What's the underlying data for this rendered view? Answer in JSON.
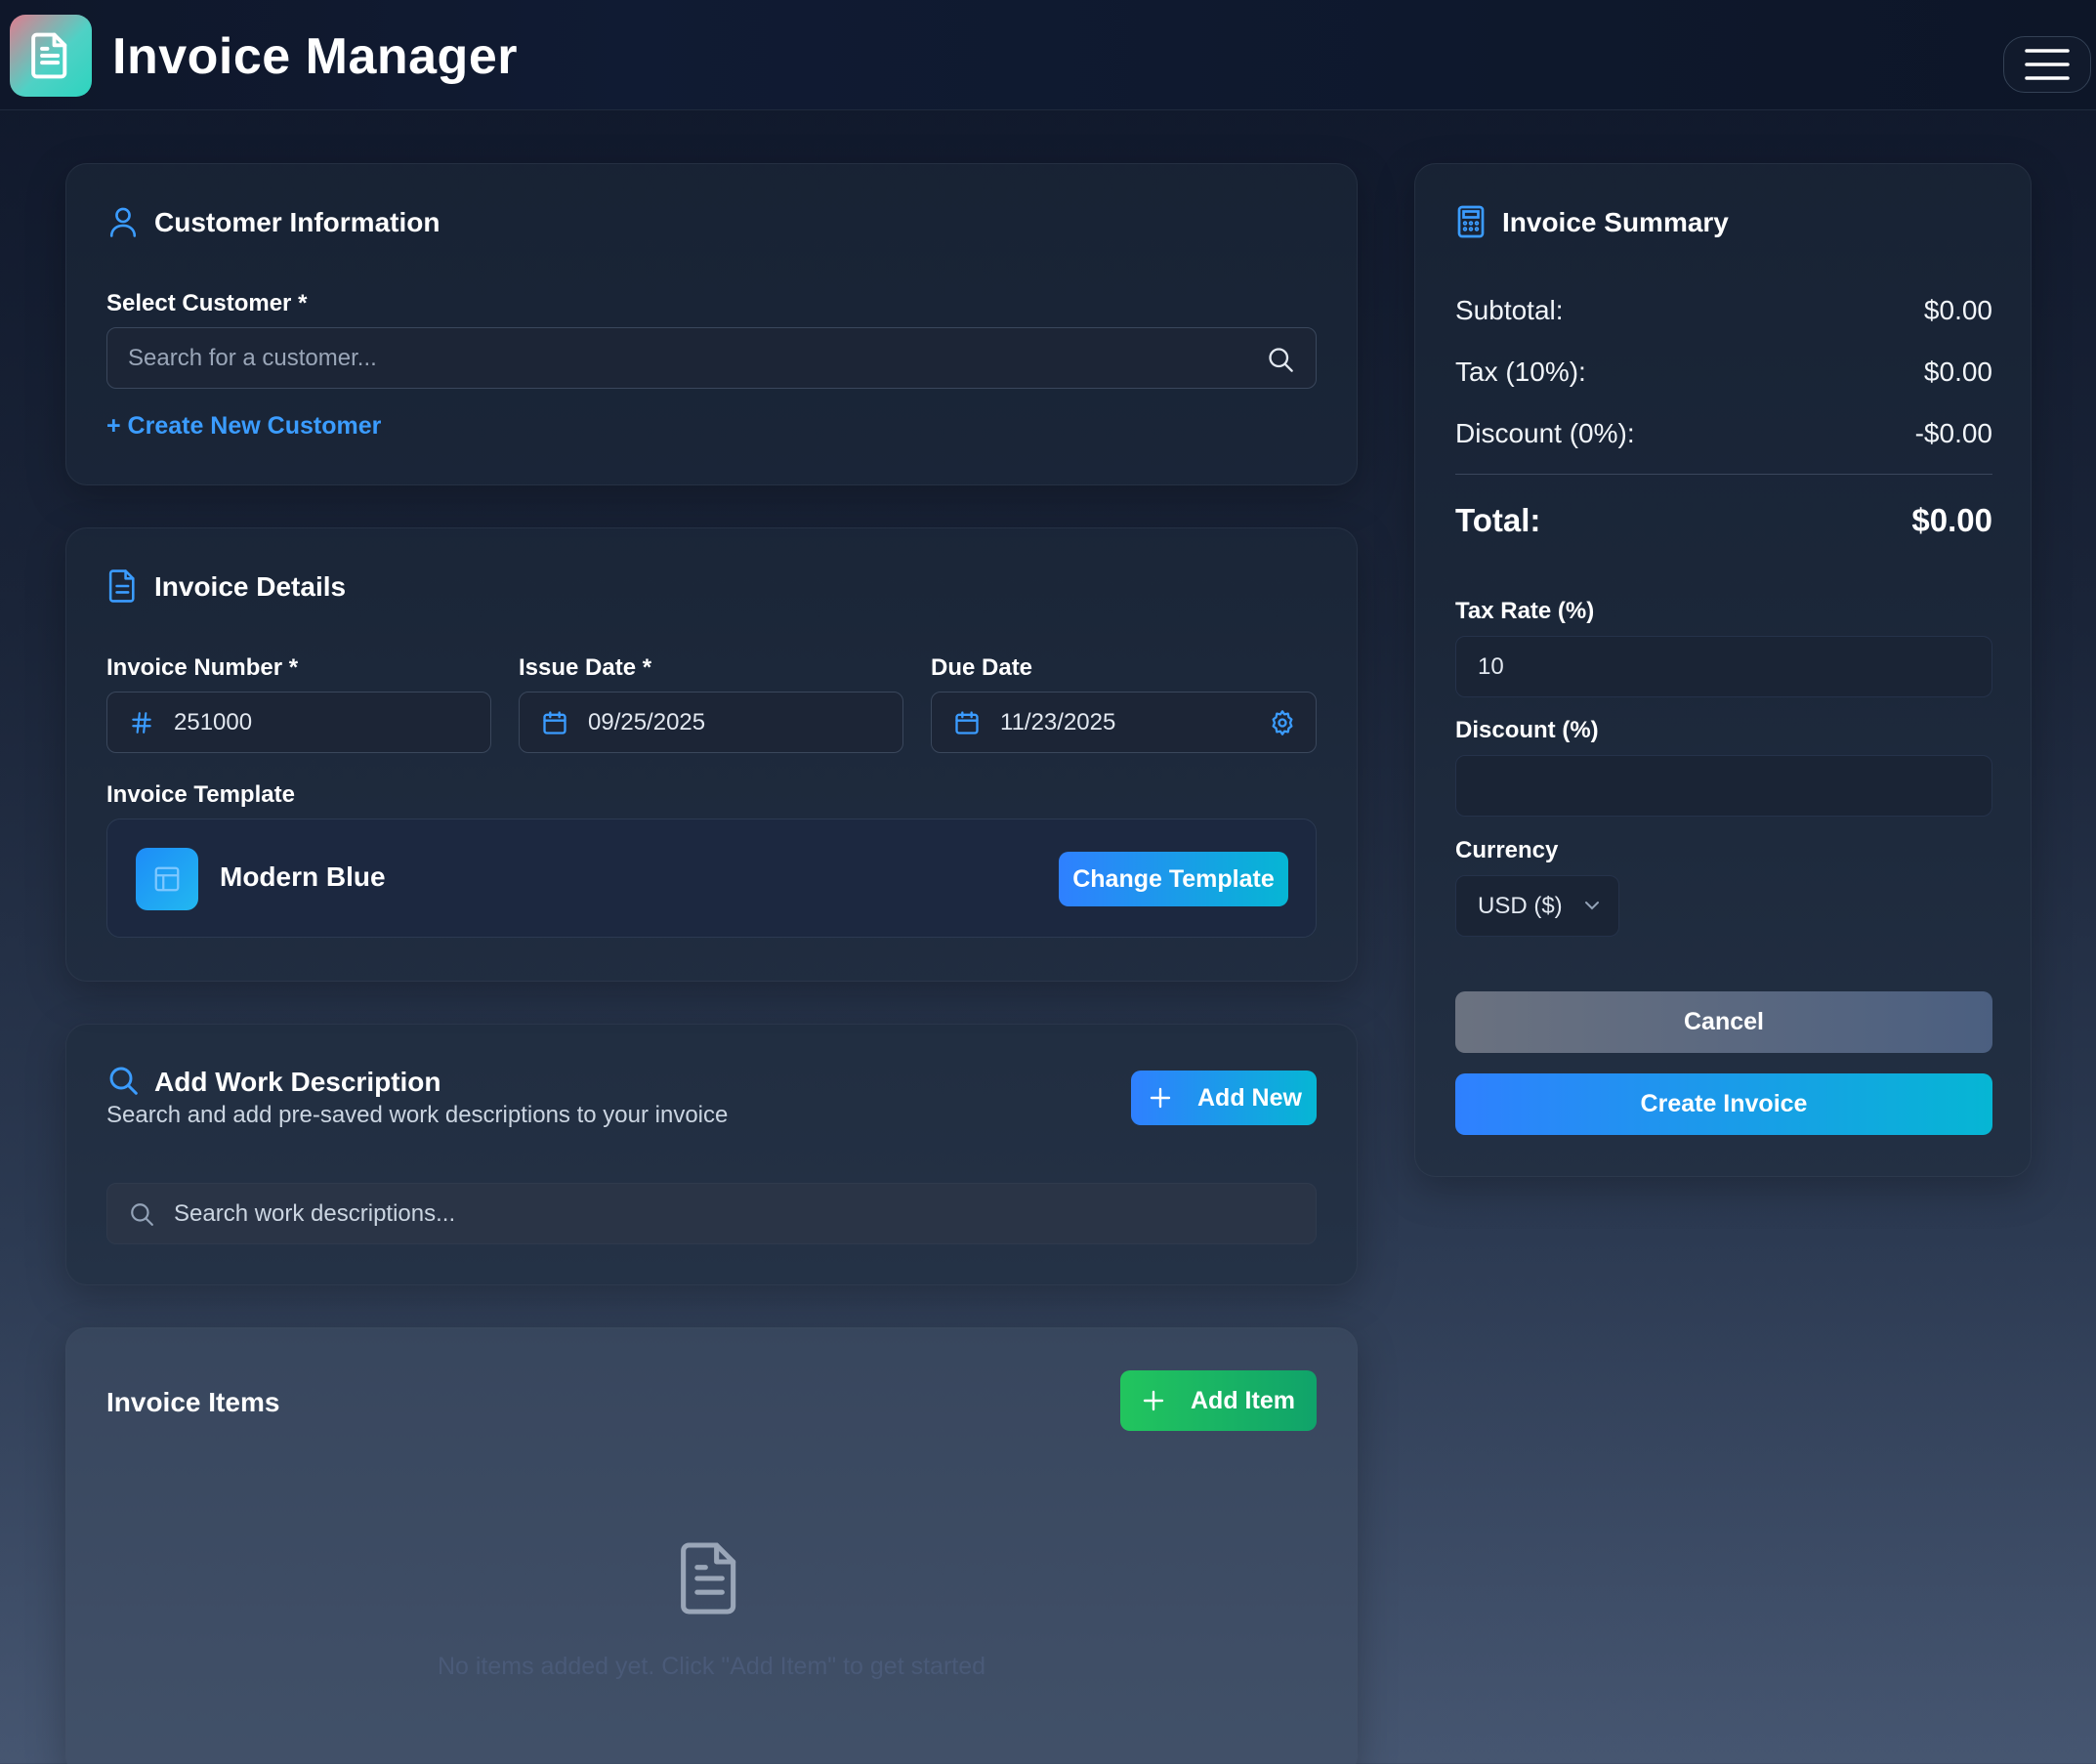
{
  "header": {
    "app_title": "Invoice Manager"
  },
  "customer_info": {
    "title": "Customer Information",
    "select_label": "Select Customer *",
    "search_placeholder": "Search for a customer...",
    "create_link": "+ Create New Customer"
  },
  "invoice_details": {
    "title": "Invoice Details",
    "invoice_number_label": "Invoice Number *",
    "invoice_number_value": "251000",
    "issue_date_label": "Issue Date *",
    "issue_date_value": "09/25/2025",
    "due_date_label": "Due Date",
    "due_date_value": "11/23/2025",
    "template_label": "Invoice Template",
    "template_name": "Modern Blue",
    "change_template_label": "Change Template"
  },
  "work_description": {
    "title": "Add Work Description",
    "subtitle": "Search and add pre-saved work descriptions to your invoice",
    "add_new_label": "Add New",
    "search_placeholder": "Search work descriptions..."
  },
  "invoice_items": {
    "title": "Invoice Items",
    "add_item_label": "Add Item",
    "empty_text": "No items added yet. Click \"Add Item\" to get started"
  },
  "summary": {
    "title": "Invoice Summary",
    "subtotal_label": "Subtotal:",
    "subtotal_value": "$0.00",
    "tax_label": "Tax (10%):",
    "tax_value": "$0.00",
    "discount_label": "Discount (0%):",
    "discount_value": "-$0.00",
    "total_label": "Total:",
    "total_value": "$0.00",
    "tax_rate_label": "Tax Rate (%)",
    "tax_rate_value": "10",
    "discount_field_label": "Discount (%)",
    "discount_field_value": "",
    "currency_label": "Currency",
    "currency_value": "USD ($)",
    "cancel_label": "Cancel",
    "create_label": "Create Invoice"
  },
  "colors": {
    "accent_blue": "#3b82f6",
    "link_blue": "#3b9cff",
    "green": "#22c55e",
    "cyan": "#06b6d4"
  },
  "icons": [
    "document-icon",
    "menu-icon",
    "user-icon",
    "search-icon",
    "hash-icon",
    "calendar-icon",
    "gear-icon",
    "layout-icon",
    "plus-icon",
    "calculator-icon",
    "chevron-down-icon"
  ]
}
